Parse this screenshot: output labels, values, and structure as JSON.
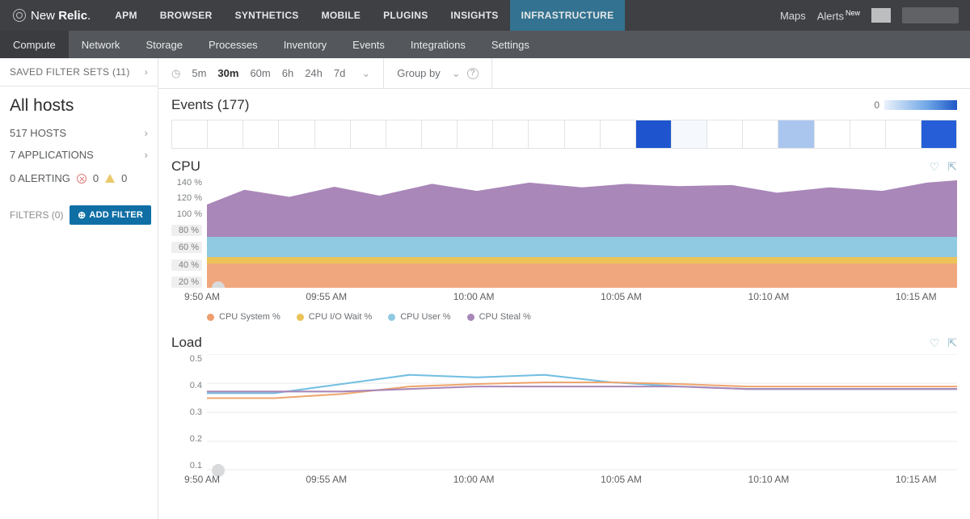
{
  "brand": {
    "pre": "New",
    "post": "Relic"
  },
  "topnav": {
    "items": [
      "APM",
      "BROWSER",
      "SYNTHETICS",
      "MOBILE",
      "PLUGINS",
      "INSIGHTS",
      "INFRASTRUCTURE"
    ],
    "active": 6
  },
  "topright": {
    "maps": "Maps",
    "alerts": "Alerts",
    "alerts_badge": "New"
  },
  "subnav": {
    "items": [
      "Compute",
      "Network",
      "Storage",
      "Processes",
      "Inventory",
      "Events",
      "Integrations",
      "Settings"
    ],
    "active": 0
  },
  "sidebar": {
    "saved_filter_sets": "SAVED FILTER SETS (11)",
    "all_hosts": "All hosts",
    "hosts": "517 HOSTS",
    "apps": "7 APPLICATIONS",
    "alerting_label": "0 ALERTING",
    "alerting_red": "0",
    "alerting_yel": "0",
    "filters_label": "FILTERS (0)",
    "add_filter": "ADD FILTER"
  },
  "toolbar": {
    "ranges": [
      "5m",
      "30m",
      "60m",
      "6h",
      "24h",
      "7d"
    ],
    "active": 1,
    "groupby": "Group by"
  },
  "events": {
    "title": "Events (177)",
    "scale_zero": "0"
  },
  "cpu": {
    "title": "CPU"
  },
  "load": {
    "title": "Load"
  },
  "legend": [
    "CPU System %",
    "CPU I/O Wait %",
    "CPU User %",
    "CPU Steal %"
  ],
  "chart_data": [
    {
      "type": "area",
      "title": "CPU",
      "ylabel": "%",
      "ylim": [
        0,
        140
      ],
      "yticks": [
        "140 %",
        "120 %",
        "100 %",
        "80 %",
        "60 %",
        "40 %",
        "20 %"
      ],
      "x": [
        "9:50 AM",
        "09:55 AM",
        "10:00 AM",
        "10:05 AM",
        "10:10 AM",
        "10:15 AM"
      ],
      "series": [
        {
          "name": "CPU System %",
          "color": "#ee9d6d",
          "values": [
            28,
            28,
            28,
            29,
            29,
            28,
            28,
            28,
            28,
            28,
            28,
            28
          ]
        },
        {
          "name": "CPU I/O Wait %",
          "color": "#ecc358",
          "values": [
            8,
            8,
            8,
            8,
            9,
            8,
            8,
            8,
            8,
            8,
            8,
            8
          ]
        },
        {
          "name": "CPU User %",
          "color": "#8fc9e2",
          "values": [
            24,
            24,
            24,
            24,
            24,
            24,
            24,
            24,
            24,
            24,
            24,
            24
          ]
        },
        {
          "name": "CPU Steal %",
          "color": "#a987b8",
          "values": [
            55,
            64,
            60,
            68,
            62,
            72,
            70,
            70,
            68,
            64,
            66,
            74
          ]
        }
      ]
    },
    {
      "type": "line",
      "title": "Load",
      "ylim": [
        0,
        0.5
      ],
      "yticks": [
        "0.5",
        "0.4",
        "0.3",
        "0.2",
        "0.1"
      ],
      "x": [
        "9:50 AM",
        "09:55 AM",
        "10:00 AM",
        "10:05 AM",
        "10:10 AM",
        "10:15 AM"
      ],
      "series": [
        {
          "name": "blue",
          "color": "#73bfe2",
          "values": [
            0.33,
            0.33,
            0.37,
            0.41,
            0.4,
            0.41,
            0.38,
            0.36,
            0.35,
            0.35,
            0.35,
            0.35
          ]
        },
        {
          "name": "orange",
          "color": "#eea66f",
          "values": [
            0.31,
            0.31,
            0.33,
            0.36,
            0.37,
            0.38,
            0.38,
            0.37,
            0.36,
            0.36,
            0.36,
            0.36
          ]
        },
        {
          "name": "purple",
          "color": "#a987b8",
          "values": [
            0.34,
            0.34,
            0.34,
            0.35,
            0.36,
            0.36,
            0.36,
            0.36,
            0.35,
            0.35,
            0.35,
            0.35
          ]
        }
      ]
    }
  ]
}
